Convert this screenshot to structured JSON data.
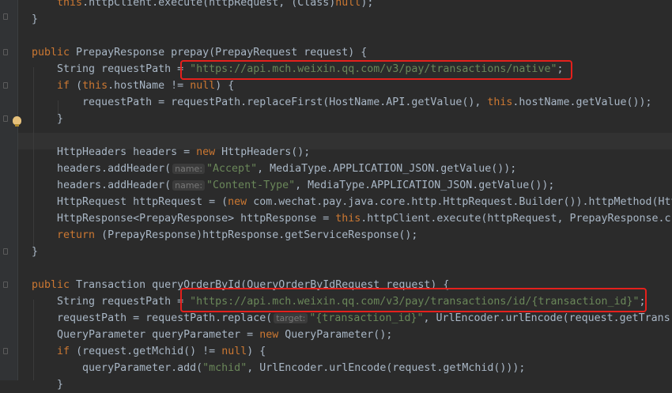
{
  "editor": {
    "language": "Java",
    "colors": {
      "background": "#2b2b2b",
      "keyword": "#cc7832",
      "string": "#6a8759",
      "identifier": "#a9b7c6",
      "hint": "#787878",
      "highlight_box": "#e4201c"
    },
    "lines": [
      [
        {
          "t": "    "
        },
        {
          "t": "this",
          "c": "kw"
        },
        {
          "t": ".httpClient.execute(httpRequest, (Class)"
        },
        {
          "t": "null",
          "c": "kw"
        },
        {
          "t": ");"
        }
      ],
      [
        {
          "t": "}"
        }
      ],
      [],
      [
        {
          "t": "public ",
          "c": "kw"
        },
        {
          "t": "PrepayResponse prepay(PrepayRequest request) {"
        }
      ],
      [
        {
          "t": "    String requestPath = "
        },
        {
          "t": "\"https://api.mch.weixin.qq.com/v3/pay/transactions/native\"",
          "c": "str"
        },
        {
          "t": ";"
        }
      ],
      [
        {
          "t": "    "
        },
        {
          "t": "if ",
          "c": "kw"
        },
        {
          "t": "("
        },
        {
          "t": "this",
          "c": "kw"
        },
        {
          "t": ".hostName != "
        },
        {
          "t": "null",
          "c": "kw"
        },
        {
          "t": ") {"
        }
      ],
      [
        {
          "t": "        requestPath = requestPath.replaceFirst(HostName.API.getValue(), "
        },
        {
          "t": "this",
          "c": "kw"
        },
        {
          "t": ".hostName.getValue());"
        }
      ],
      [
        {
          "t": "    }"
        }
      ],
      [],
      [
        {
          "t": "    HttpHeaders headers = "
        },
        {
          "t": "new ",
          "c": "kw"
        },
        {
          "t": "HttpHeaders();"
        }
      ],
      [
        {
          "t": "    headers.addHeader("
        },
        {
          "t": "name:",
          "c": "hint"
        },
        {
          "t": "\"Accept\"",
          "c": "str"
        },
        {
          "t": ", MediaType.APPLICATION_JSON.getValue());"
        }
      ],
      [
        {
          "t": "    headers.addHeader("
        },
        {
          "t": "name:",
          "c": "hint"
        },
        {
          "t": "\"Content-Type\"",
          "c": "str"
        },
        {
          "t": ", MediaType.APPLICATION_JSON.getValue());"
        }
      ],
      [
        {
          "t": "    HttpRequest httpRequest = ("
        },
        {
          "t": "new ",
          "c": "kw"
        },
        {
          "t": "com.wechat.pay.java.core.http.HttpRequest.Builder()).httpMethod(Htt"
        }
      ],
      [
        {
          "t": "    HttpResponse<PrepayResponse> httpResponse = "
        },
        {
          "t": "this",
          "c": "kw"
        },
        {
          "t": ".httpClient.execute(httpRequest, PrepayResponse.c"
        }
      ],
      [
        {
          "t": "    "
        },
        {
          "t": "return ",
          "c": "kw"
        },
        {
          "t": "(PrepayResponse)httpResponse.getServiceResponse();"
        }
      ],
      [
        {
          "t": "}"
        }
      ],
      [],
      [
        {
          "t": "public ",
          "c": "kw"
        },
        {
          "t": "Transaction queryOrderById(QueryOrderByIdRequest request) {"
        }
      ],
      [
        {
          "t": "    String requestPath = "
        },
        {
          "t": "\"https://api.mch.weixin.qq.com/v3/pay/transactions/id/{transaction_id}\"",
          "c": "str"
        },
        {
          "t": ";"
        }
      ],
      [
        {
          "t": "    requestPath = requestPath.replace("
        },
        {
          "t": "target:",
          "c": "hint"
        },
        {
          "t": "\"{transaction_id}\"",
          "c": "str"
        },
        {
          "t": ", UrlEncoder.urlEncode(request.getTrans"
        }
      ],
      [
        {
          "t": "    QueryParameter queryParameter = "
        },
        {
          "t": "new ",
          "c": "kw"
        },
        {
          "t": "QueryParameter();"
        }
      ],
      [
        {
          "t": "    "
        },
        {
          "t": "if ",
          "c": "kw"
        },
        {
          "t": "(request.getMchid() != "
        },
        {
          "t": "null",
          "c": "kw"
        },
        {
          "t": ") {"
        }
      ],
      [
        {
          "t": "        queryParameter.add("
        },
        {
          "t": "\"mchid\"",
          "c": "str"
        },
        {
          "t": ", UrlEncoder.urlEncode(request.getMchid()));"
        }
      ],
      [
        {
          "t": "    }"
        }
      ]
    ],
    "current_line_index": 8,
    "highlight_boxes": [
      {
        "line_index": 4,
        "label": "prepay request path"
      },
      {
        "line_index": 18,
        "label": "queryOrderById request path"
      }
    ]
  }
}
